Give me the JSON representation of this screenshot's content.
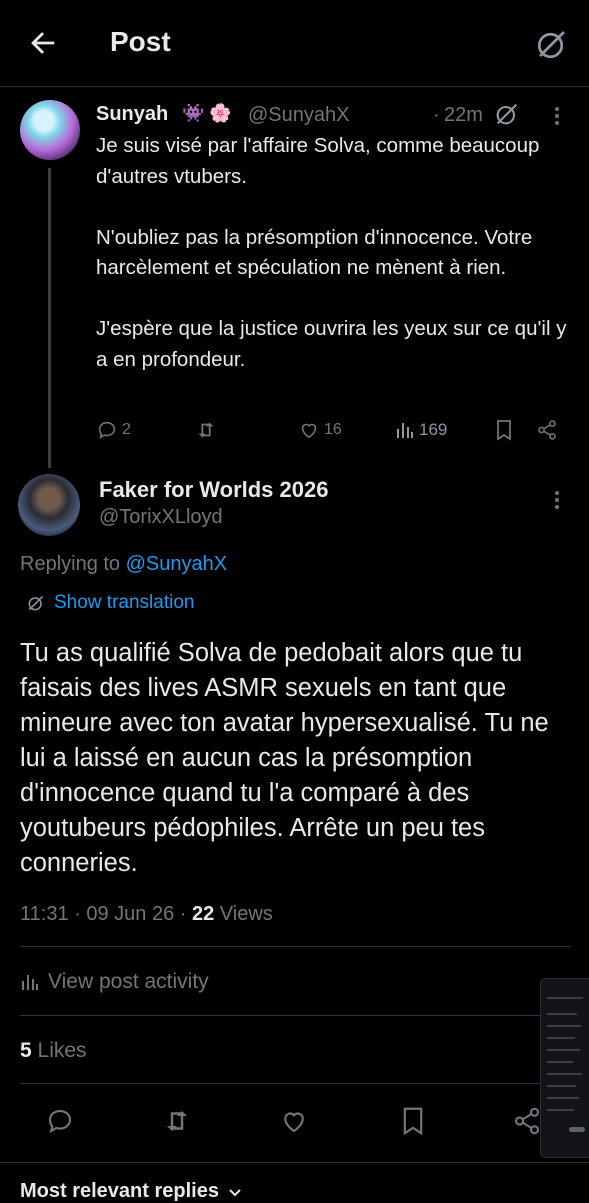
{
  "header": {
    "title": "Post"
  },
  "parent_post": {
    "name": "Sunyah",
    "badges": "👾 🌸",
    "handle": "@SunyahX",
    "dot": "·",
    "time": "22m",
    "text": "Je suis visé par l'affaire Solva, comme beaucoup d'autres vtubers.\n\nN'oubliez pas la présomption d'innocence. Votre harcèlement et spéculation ne mènent à rien.\n\nJ'espère que la justice ouvrira les yeux sur ce qu'il y a en profondeur.",
    "replies": "2",
    "likes": "16",
    "views": "169"
  },
  "post": {
    "name": "Faker for Worlds 2026",
    "handle": "@TorixXLloyd",
    "replying_prefix": "Replying to ",
    "replying_handle": "@SunyahX",
    "show_translation": "Show translation",
    "text": "Tu as qualifié Solva de pedobait alors que tu faisais des lives ASMR sexuels en tant que mineure avec ton avatar hypersexualisé. Tu ne lui a laissé en aucun cas la présomption d'innocence quand tu l'a comparé à des youtubeurs pédophiles. Arrête un peu tes conneries.",
    "time": "11:31 · 09 Jun 26 · ",
    "views_count": "22",
    "views_label": " Views",
    "view_activity": "View post activity",
    "likes_count": "5",
    "likes_label": " Likes"
  },
  "replies_sort": {
    "label": "Most relevant replies"
  },
  "colors": {
    "accent": "#1d9bf0",
    "muted": "#71767b",
    "background": "#000000",
    "text": "#e7e9ea"
  },
  "icons": [
    "back-arrow-icon",
    "grok-icon",
    "more-icon",
    "reply-icon",
    "retweet-icon",
    "like-icon",
    "views-icon",
    "bookmark-icon",
    "share-icon",
    "translate-icon",
    "chevron-down-icon"
  ]
}
